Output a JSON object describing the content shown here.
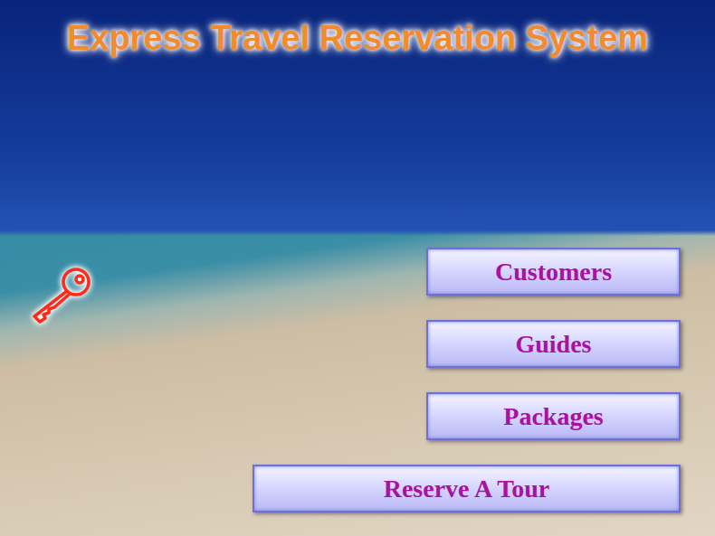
{
  "window": {
    "title": "Express Travel Reservation System"
  },
  "menu": [
    {
      "label": "Customers"
    },
    {
      "label": "Guides"
    },
    {
      "label": "Packages"
    },
    {
      "label": "Reserve A Tour"
    }
  ]
}
